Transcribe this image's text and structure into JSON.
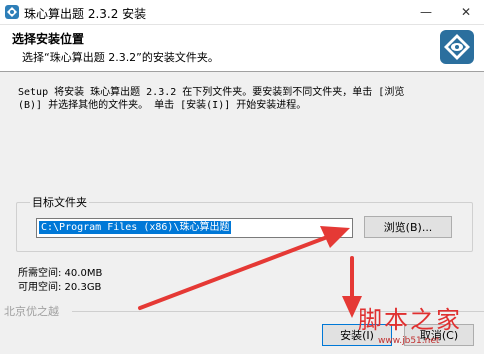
{
  "window": {
    "title": "珠心算出题 2.3.2 安装",
    "minimize_icon": "minimize-icon",
    "close_icon": "close-icon"
  },
  "header": {
    "title": "选择安装位置",
    "subtitle": "选择“珠心算出题 2.3.2”的安装文件夹。"
  },
  "description": {
    "line1": "Setup 将安装 珠心算出题 2.3.2 在下列文件夹。要安装到不同文件夹，单击 [浏览",
    "line2": "(B)] 并选择其他的文件夹。 单击 [安装(I)] 开始安装进程。"
  },
  "destination": {
    "group_label": "目标文件夹",
    "path_value": "C:\\Program Files (x86)\\珠心算出题",
    "browse_label": "浏览(B)..."
  },
  "space": {
    "required": "所需空间: 40.0MB",
    "available": "可用空间: 20.3GB"
  },
  "footer": {
    "brand": "北京优之越",
    "install_label": "安装(I)",
    "cancel_label": "取消(C)"
  },
  "watermark": {
    "text": "脚本之家",
    "url": "www.jb51.net"
  },
  "colors": {
    "selection": "#0078d7",
    "arrow": "#e53935",
    "watermark": "#e03030"
  }
}
